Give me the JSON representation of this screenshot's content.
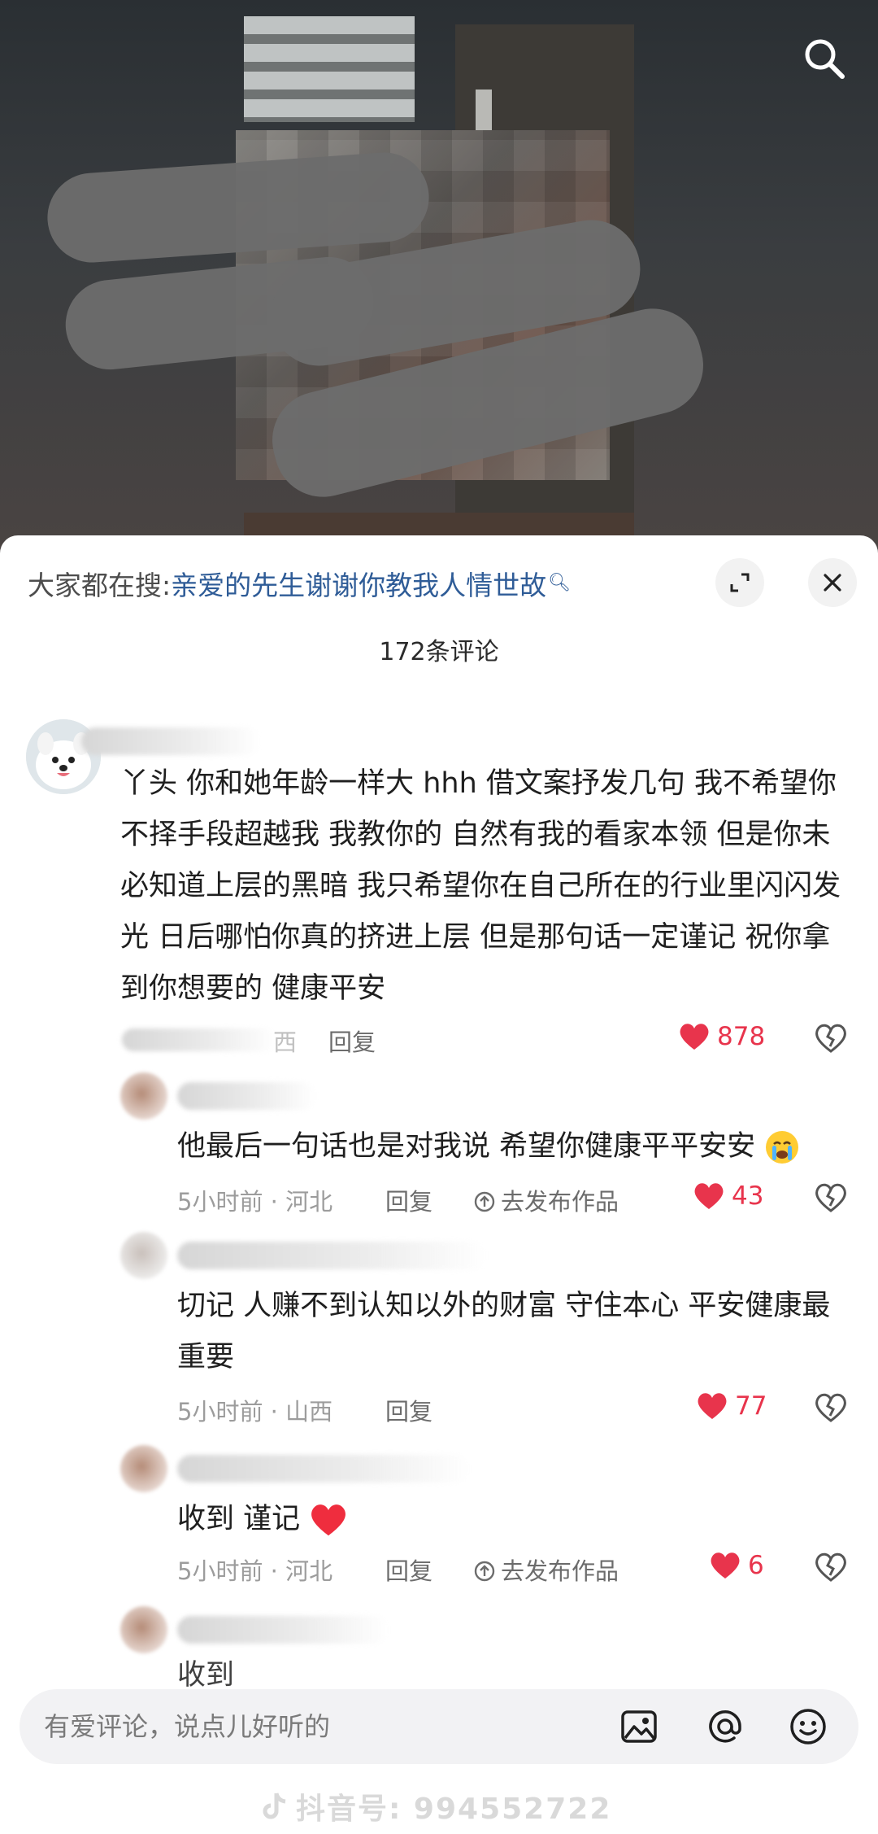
{
  "video": {
    "search_icon": "search-icon"
  },
  "panel": {
    "hot_search_prefix": "大家都在搜:",
    "hot_search_topic": "亲爱的先生谢谢你教我人情世故",
    "hot_search_icon": "search-icon",
    "expand_icon": "expand-icon",
    "close_icon": "close-icon",
    "comment_count": "172条评论"
  },
  "comments": [
    {
      "text": "丫头 你和她年龄一样大 hhh 借文案抒发几句 我不希望你不择手段超越我 我教你的 自然有我的看家本领 但是你未必知道上层的黑暗 我只希望你在自己所在的行业里闪闪发光 日后哪怕你真的挤进上层 但是那句话一定谨记 祝你拿到你想要的 健康平安",
      "meta": "西",
      "reply": "回复",
      "likes": "878"
    },
    {
      "text": "他最后一句话也是对我说 希望你健康平平安安",
      "emoji": "crying-face-emoji",
      "meta": "5小时前 · 河北",
      "reply": "回复",
      "publish": "去发布作品",
      "likes": "43"
    },
    {
      "text": "切记 人赚不到认知以外的财富 守住本心 平安健康最重要",
      "meta": "5小时前 · 山西",
      "reply": "回复",
      "likes": "77"
    },
    {
      "text": "收到 谨记",
      "emoji": "red-heart-emoji",
      "meta": "5小时前 · 河北",
      "reply": "回复",
      "publish": "去发布作品",
      "likes": "6"
    },
    {
      "text": "收到"
    }
  ],
  "input": {
    "placeholder": "有爱评论，说点儿好听的",
    "image_icon": "image-icon",
    "mention_icon": "at-icon",
    "emoji_icon": "emoji-icon"
  },
  "watermark": "抖音号: 994552722",
  "colors": {
    "like_red": "#e8344c",
    "link_blue": "#2f5c97",
    "meta_gray": "#9c9c9c"
  }
}
